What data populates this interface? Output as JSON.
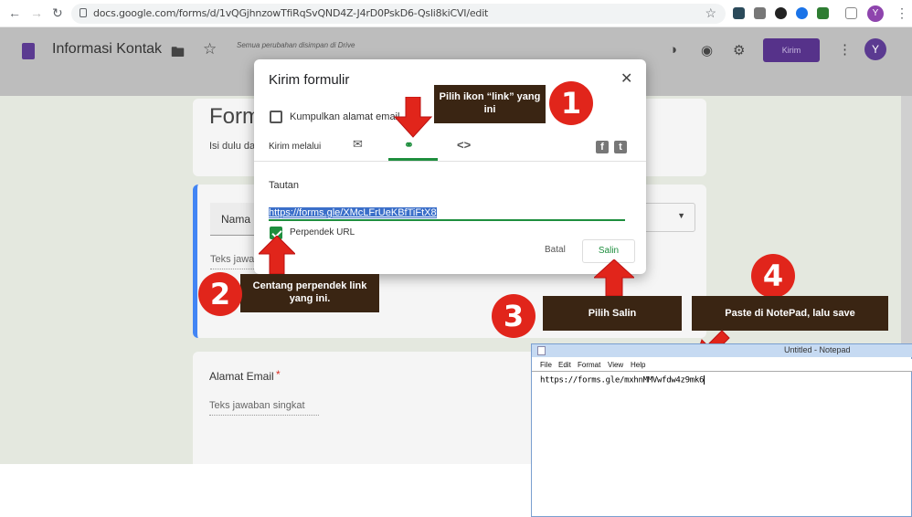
{
  "browser": {
    "url": "docs.google.com/forms/d/1vQGjhnzowTfiRqSvQND4Z-J4rD0PskD6-Qsli8kiCVI/edit",
    "profile_initial": "Y"
  },
  "forms": {
    "title": "Informasi Kontak",
    "saved_note": "Semua perubahan disimpan di Drive",
    "send_button": "Kirim",
    "avatar_initial": "Y",
    "form_title": "Form",
    "form_desc": "Isi dulu da",
    "name_label": "Nama l",
    "answer_hint_1": "Teks jawab",
    "email_label": "Alamat Email",
    "required_mark": "*",
    "answer_hint_2": "Teks jawaban singkat"
  },
  "dialog": {
    "title": "Kirim formulir",
    "collect_email_label": "Kumpulkan alamat email",
    "send_via_label": "Kirim melalui",
    "link_heading": "Tautan",
    "link_url": "https://forms.gle/XMcLFrUeKBfTiFtX8",
    "shorten_label": "Perpendek URL",
    "cancel_button": "Batal",
    "copy_button": "Salin"
  },
  "annotations": {
    "step1_text": "Pilih ikon “link” yang ini",
    "step1_num": "1",
    "step2_text": "Centang perpendek link yang ini.",
    "step2_num": "2",
    "step3_text": "Pilih Salin",
    "step3_num": "3",
    "step4_text": "Paste di NotePad, lalu save",
    "step4_num": "4",
    "arrow_color": "#e1251b",
    "callout_color": "#3a2513"
  },
  "notepad": {
    "title": "Untitled - Notepad",
    "menu": [
      "File",
      "Edit",
      "Format",
      "View",
      "Help"
    ],
    "content": "https://forms.gle/mxhnMMVwfdw4z9mk6"
  }
}
